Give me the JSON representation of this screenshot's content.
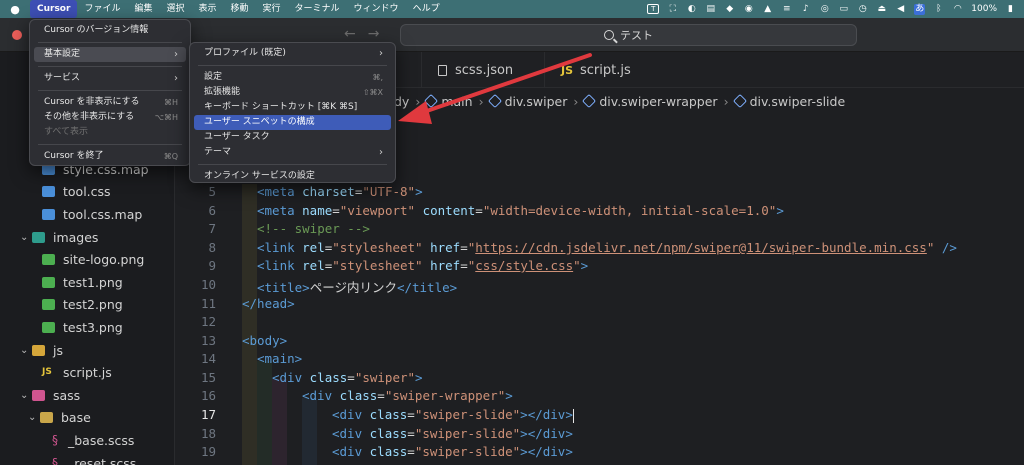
{
  "menubar": {
    "apple": "",
    "app": "Cursor",
    "items": [
      "ファイル",
      "編集",
      "選択",
      "表示",
      "移動",
      "実行",
      "ターミナル",
      "ウィンドウ",
      "ヘルプ"
    ],
    "ime": "あ",
    "battery": "100%"
  },
  "titlebar": {
    "search_text": "テスト"
  },
  "app_menu": {
    "items": [
      {
        "label": "Cursor のバージョン情報"
      },
      {
        "label": "基本設定"
      },
      {
        "label": "サービス"
      },
      {
        "label": "Cursor を非表示にする",
        "shortcut": "⌘H"
      },
      {
        "label": "その他を非表示にする",
        "shortcut": "⌥⌘H"
      },
      {
        "label": "すべて表示"
      },
      {
        "label": "Cursor を終了",
        "shortcut": "⌘Q"
      }
    ]
  },
  "prefs_menu": {
    "items": [
      {
        "label": "プロファイル (既定)"
      },
      {
        "label": "設定",
        "shortcut": "⌘,"
      },
      {
        "label": "拡張機能",
        "shortcut": "⇧⌘X"
      },
      {
        "label": "キーボード ショートカット [⌘K ⌘S]"
      },
      {
        "label": "ユーザー スニペットの構成"
      },
      {
        "label": "ユーザー タスク"
      },
      {
        "label": "テーマ"
      },
      {
        "label": "オンライン サービスの設定"
      }
    ]
  },
  "sidebar": {
    "items": [
      {
        "label": "style.css.map",
        "icon": "css-file-icon"
      },
      {
        "label": "tool.css",
        "icon": "css-file-icon"
      },
      {
        "label": "tool.css.map",
        "icon": "css-file-icon"
      },
      {
        "label": "images",
        "icon": "folder-icon"
      },
      {
        "label": "site-logo.png",
        "icon": "image-file-icon"
      },
      {
        "label": "test1.png",
        "icon": "image-file-icon"
      },
      {
        "label": "test2.png",
        "icon": "image-file-icon"
      },
      {
        "label": "test3.png",
        "icon": "image-file-icon"
      },
      {
        "label": "js",
        "icon": "folder-icon"
      },
      {
        "label": "script.js",
        "icon": "js-file-icon",
        "badge": "JS"
      },
      {
        "label": "sass",
        "icon": "folder-icon"
      },
      {
        "label": "base",
        "icon": "folder-icon"
      },
      {
        "label": "_base.scss",
        "icon": "scss-file-icon"
      },
      {
        "label": "_reset.scss",
        "icon": "scss-file-icon"
      }
    ]
  },
  "tabs": [
    {
      "label": "scss.json"
    },
    {
      "label": "script.js",
      "badge": "JS"
    }
  ],
  "breadcrumb": [
    "dy",
    "main",
    "div.swiper",
    "div.swiper-wrapper",
    "div.swiper-slide"
  ],
  "editor": {
    "line_numbers": [
      "5",
      "6",
      "7",
      "8",
      "9",
      "10",
      "11",
      "12",
      "13",
      "14",
      "15",
      "16",
      "17",
      "18",
      "19"
    ],
    "current_line": "17",
    "tokens": {
      "meta_charset": [
        "<meta ",
        "charset",
        "=",
        "\"UTF-8\"",
        ">"
      ],
      "meta_viewport": [
        "<meta ",
        "name",
        "=",
        "\"viewport\"",
        " content",
        "=",
        "\"width=device-width, initial-scale=1.0\"",
        ">"
      ],
      "comment": "<!-- swiper -->",
      "link1": [
        "<link ",
        "rel",
        "=",
        "\"stylesheet\"",
        " href",
        "=",
        "\"",
        "https://cdn.jsdelivr.net/npm/swiper@11/swiper-bundle.min.css",
        "\"",
        " />"
      ],
      "link2": [
        "<link ",
        "rel",
        "=",
        "\"stylesheet\"",
        " href",
        "=",
        "\"",
        "css/style.css",
        "\"",
        ">"
      ],
      "title": [
        "<title>",
        "ページ内リンク",
        "</title>"
      ],
      "head_close": "</head>",
      "body_open": "<body>",
      "main_open": "<main>",
      "div_swiper": [
        "<div ",
        "class",
        "=",
        "\"swiper\"",
        ">"
      ],
      "div_wrapper": [
        "<div ",
        "class",
        "=",
        "\"swiper-wrapper\"",
        ">"
      ],
      "div_slide": [
        "<div ",
        "class",
        "=",
        "\"swiper-slide\"",
        "></div>"
      ]
    }
  },
  "colors": {
    "menubar_bg": "#3d6f74",
    "menu_highlight": "#3e5cb8",
    "annotation_arrow": "#e0393e"
  }
}
